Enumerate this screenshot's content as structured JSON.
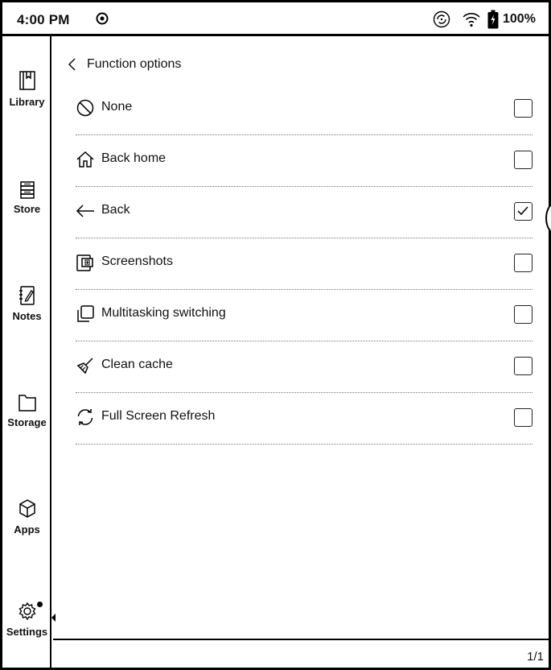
{
  "status_bar": {
    "time": "4:00 PM",
    "battery_percent": "100%"
  },
  "sidebar": {
    "items": [
      {
        "label": "Library",
        "icon": "library-icon"
      },
      {
        "label": "Store",
        "icon": "store-icon"
      },
      {
        "label": "Notes",
        "icon": "notes-icon"
      },
      {
        "label": "Storage",
        "icon": "storage-icon"
      },
      {
        "label": "Apps",
        "icon": "apps-icon"
      },
      {
        "label": "Settings",
        "icon": "settings-icon",
        "active": true
      }
    ]
  },
  "main": {
    "title": "Function options",
    "options": [
      {
        "label": "None",
        "icon": "none-icon",
        "checked": false
      },
      {
        "label": "Back home",
        "icon": "home-icon",
        "checked": false
      },
      {
        "label": "Back",
        "icon": "back-arrow-icon",
        "checked": true
      },
      {
        "label": "Screenshots",
        "icon": "screenshot-icon",
        "checked": false
      },
      {
        "label": "Multitasking switching",
        "icon": "multitask-icon",
        "checked": false
      },
      {
        "label": "Clean cache",
        "icon": "broom-icon",
        "checked": false
      },
      {
        "label": "Full Screen Refresh",
        "icon": "refresh-icon",
        "checked": false
      }
    ],
    "page_counter": "1/1"
  }
}
